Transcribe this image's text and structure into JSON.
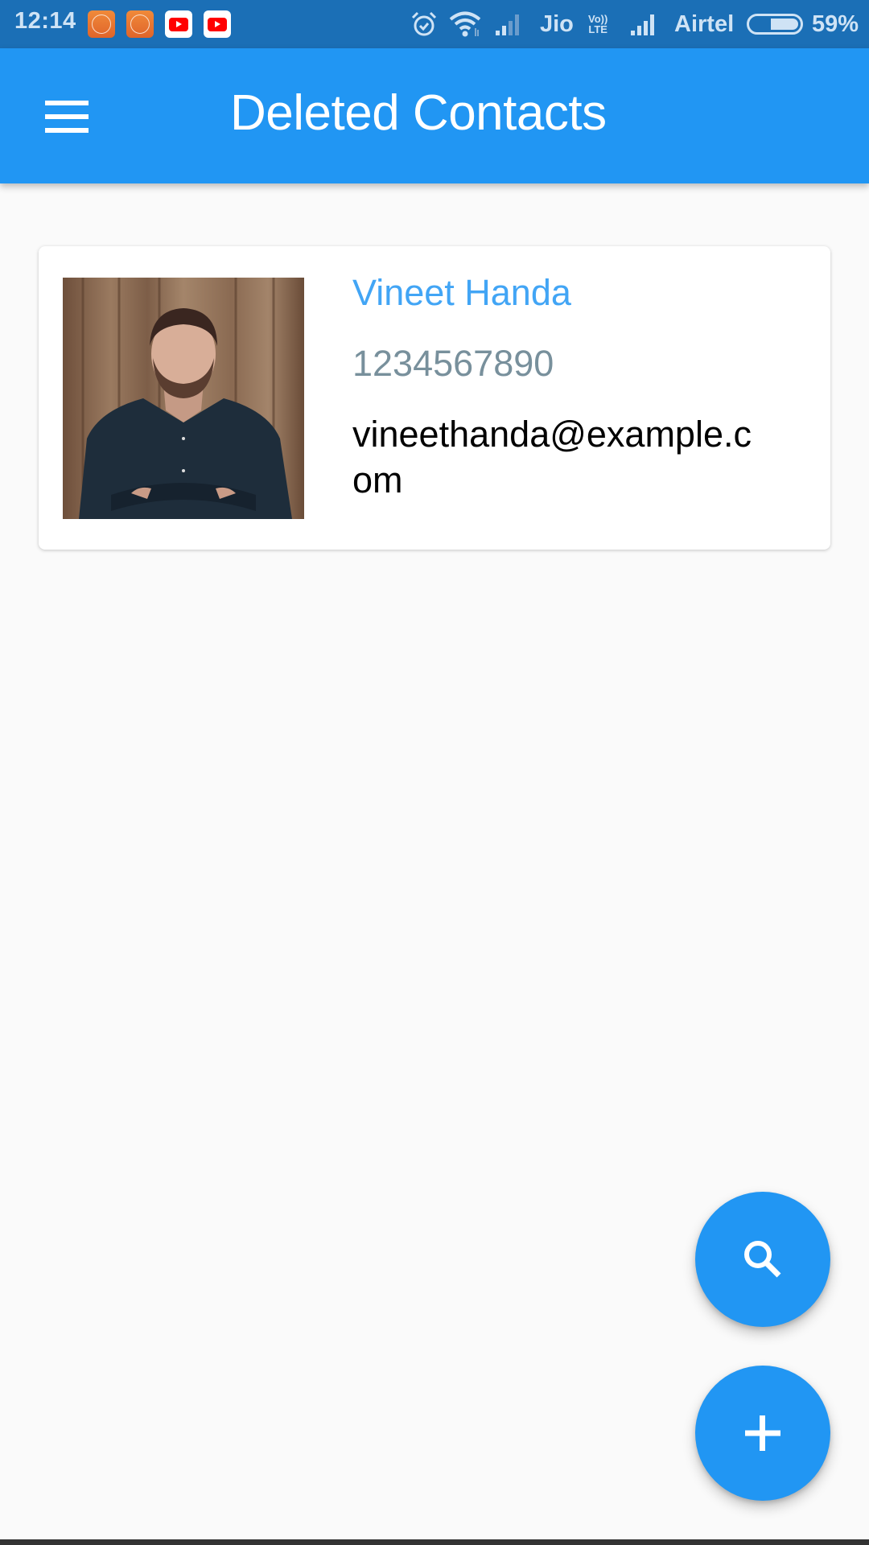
{
  "status_bar": {
    "time": "12:14",
    "notification_icons": [
      "screen-recorder-icon",
      "screen-recorder-icon",
      "youtube-icon",
      "youtube-icon"
    ],
    "carrier_1": "Jio",
    "volte_label_top": "Vo))",
    "volte_label_bottom": "LTE",
    "carrier_2": "Airtel",
    "battery_percent_label": "59%",
    "battery_level": 0.59
  },
  "app_bar": {
    "title": "Deleted Contacts",
    "menu_icon": "hamburger-menu-icon",
    "background_color": "#2196f3"
  },
  "contacts": [
    {
      "name": "Vineet Handa",
      "phone": "1234567890",
      "email": "vineethanda@example.com",
      "photo": "contact-photo"
    }
  ],
  "fabs": {
    "search_icon": "search-icon",
    "add_icon": "plus-icon",
    "color": "#2196f3"
  },
  "colors": {
    "status_bar": "#1b6fb6",
    "name_text": "#42a5f5",
    "phone_text": "#78909c",
    "email_text": "#000000",
    "page_background": "#fafafa"
  }
}
